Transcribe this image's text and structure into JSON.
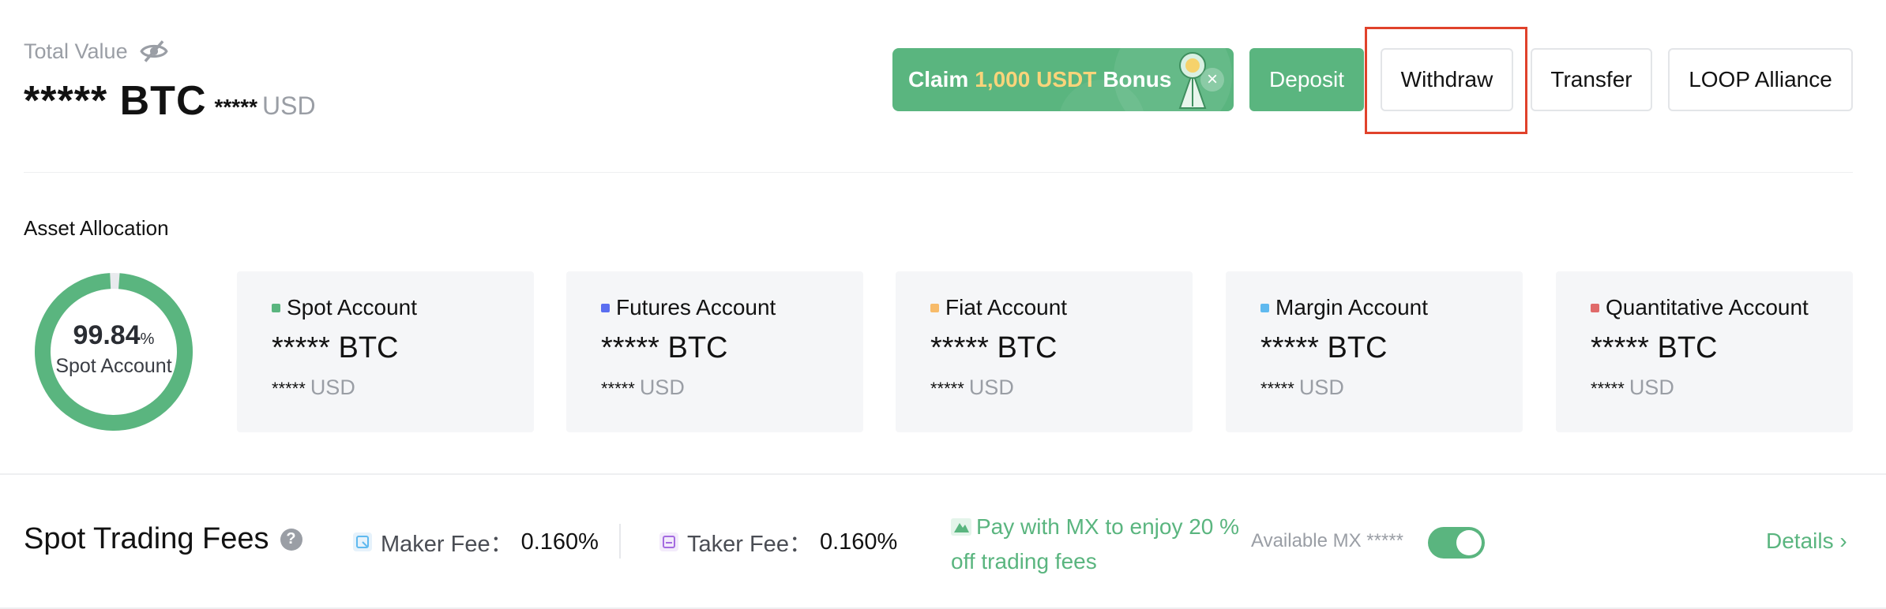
{
  "header": {
    "total_label": "Total Value",
    "btc_value": "***** BTC",
    "usd_stars": "*****",
    "usd_unit": "USD"
  },
  "banner": {
    "claim_prefix": "Claim",
    "claim_amount": "1,000 USDT",
    "claim_suffix": "Bonus",
    "close": "×"
  },
  "actions": {
    "deposit": "Deposit",
    "withdraw": "Withdraw",
    "transfer": "Transfer",
    "loop": "LOOP Alliance"
  },
  "allocation": {
    "title": "Asset Allocation",
    "donut_percent": "99.84",
    "donut_percent_sign": "%",
    "donut_label": "Spot Account",
    "spot_fraction": 0.9984,
    "accounts": [
      {
        "name": "Spot Account",
        "btc": "***** BTC",
        "usd_stars": "*****",
        "usd_unit": "USD",
        "color": "#5ab57f"
      },
      {
        "name": "Futures Account",
        "btc": "***** BTC",
        "usd_stars": "*****",
        "usd_unit": "USD",
        "color": "#5a6ef0"
      },
      {
        "name": "Fiat Account",
        "btc": "***** BTC",
        "usd_stars": "*****",
        "usd_unit": "USD",
        "color": "#f7bb6a"
      },
      {
        "name": "Margin Account",
        "btc": "***** BTC",
        "usd_stars": "*****",
        "usd_unit": "USD",
        "color": "#5fb9ef"
      },
      {
        "name": "Quantitative Account",
        "btc": "***** BTC",
        "usd_stars": "*****",
        "usd_unit": "USD",
        "color": "#e06a6a"
      }
    ]
  },
  "fees": {
    "title": "Spot Trading Fees",
    "help": "?",
    "maker_label": "Maker Fee：",
    "maker_value": "0.160%",
    "taker_label": "Taker Fee：",
    "taker_value": "0.160%",
    "promo_line1": "Pay with MX to enjoy 20 %",
    "promo_line2": "off trading fees",
    "available": "Available MX *****",
    "toggle_on": true,
    "details": "Details ›"
  },
  "colors": {
    "accent": "#5ab57f",
    "highlight": "#e0422b",
    "muted": "#9a9ea5"
  }
}
